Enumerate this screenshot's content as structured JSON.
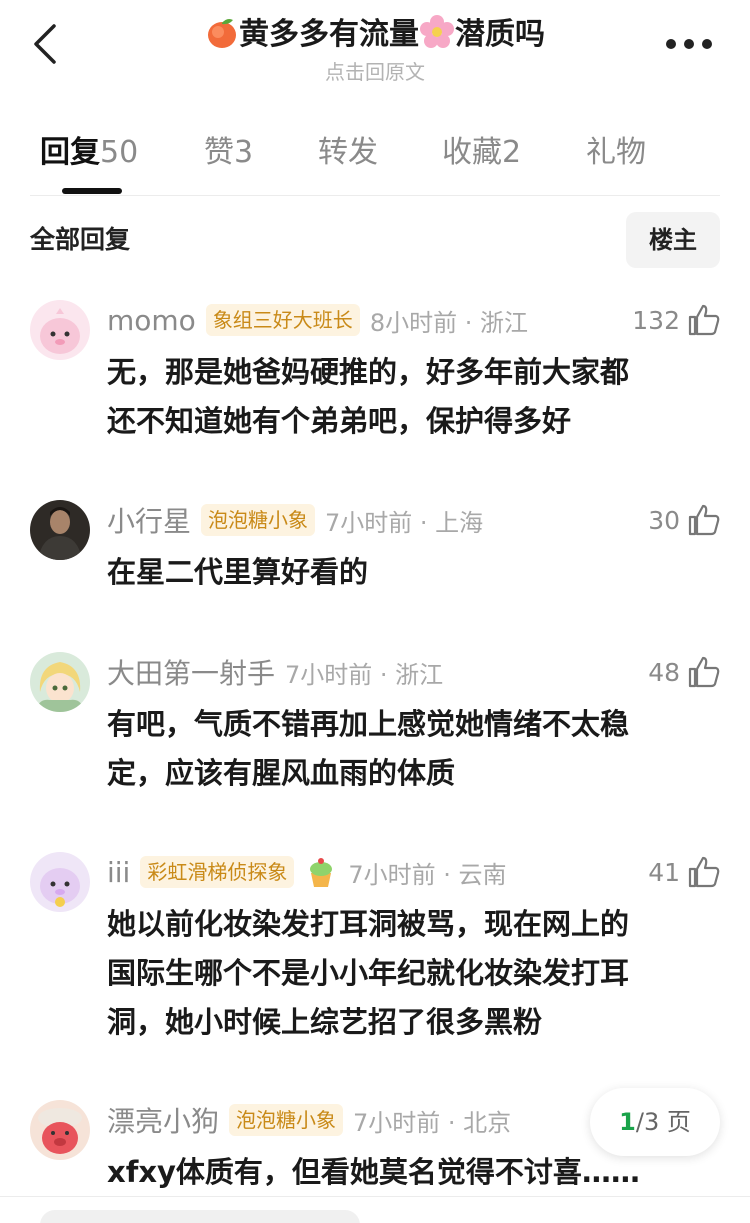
{
  "header": {
    "title_prefix_emoji": "🍑",
    "title_main": "黄多多有流量",
    "title_mid_emoji": "🌸",
    "title_tail": "潜质吗",
    "subtitle": "点击回原文"
  },
  "tabs": [
    {
      "label": "回复",
      "count": "50",
      "active": true
    },
    {
      "label": "赞",
      "count": "3",
      "active": false
    },
    {
      "label": "转发",
      "count": "",
      "active": false
    },
    {
      "label": "收藏",
      "count": "2",
      "active": false
    },
    {
      "label": "礼物",
      "count": "",
      "active": false
    }
  ],
  "filter": {
    "label": "全部回复",
    "op_button": "楼主"
  },
  "comments": [
    {
      "user": "momo",
      "badge": "象组三好大班长",
      "time": "8小时前 · 浙江",
      "likes": "132",
      "lines": [
        "无，那是她爸妈硬推的，好多年前大家都",
        "还不知道她有个弟弟吧，保护得多好"
      ],
      "avatar": "pink-elephant"
    },
    {
      "user": "小行星",
      "badge": "泡泡糖小象",
      "time": "7小时前 · 上海",
      "likes": "30",
      "lines": [
        "在星二代里算好看的"
      ],
      "avatar": "photo"
    },
    {
      "user": "大田第一射手",
      "badge": "",
      "time": "7小时前 · 浙江",
      "likes": "48",
      "lines": [
        "有吧，气质不错再加上感觉她情绪不太稳",
        "定，应该有腥风血雨的体质"
      ],
      "avatar": "anime-girl"
    },
    {
      "user": "iii",
      "badge": "彩虹滑梯侦探象",
      "time": "7小时前 · 云南",
      "likes": "41",
      "lines": [
        "她以前化妆染发打耳洞被骂，现在网上的",
        "国际生哪个不是小小年纪就化妆染发打耳",
        "洞，她小时候上综艺招了很多黑粉"
      ],
      "avatar": "purple-elephant",
      "extra_icon": "cupcake-icon"
    },
    {
      "user": "漂亮小狗",
      "badge": "泡泡糖小象",
      "time": "7小时前 · 北京",
      "likes": "",
      "lines": [
        "xfxy体质有，但看她莫名觉得不讨喜……"
      ],
      "avatar": "red-pig"
    }
  ],
  "pager": {
    "current": "1",
    "total_text": "/3 页"
  },
  "colors": {
    "accent_green": "#1aa34a",
    "badge_text": "#c98a18",
    "badge_bg": "#fdf3e0"
  }
}
